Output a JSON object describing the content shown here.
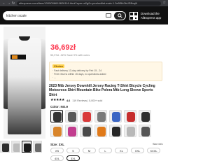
{
  "browser": {
    "url": "aliexpress.com/item/1005006619626116.html?spm=a2g0o.productlist.main.1.3e5f5b2bUSBxqN"
  },
  "header": {
    "search_value": "kitchen scale",
    "app_text": [
      "Download the",
      "AliExpress app"
    ]
  },
  "product": {
    "price": "36,69zł",
    "original_price": "53,97zł  -32%  Save 9%  with coins",
    "choice": {
      "badge": "Choice",
      "lines": [
        "· Fast delivery 13-day delivery by Feb 15 - 24",
        "· Free returns  within 15 days, no questions asked",
        "· ... "
      ]
    },
    "title": "2023 Mtb Jersey Downhill Jersey Racing T-Shirt Bicycle Cycling Motocross Shirt Mountain Bike Polera Mtb Long Sleeve Sports Shirt",
    "rating": {
      "stars": "★★★★★",
      "value": "4.6",
      "meta": "119 Reviews  |  5,000+ sold"
    },
    "color_label": "Color: NO.9",
    "swatch_colors": [
      "#333333",
      "#5a5a5a",
      "#d93a3a",
      "#7a7a7a",
      "#3b66c4",
      "#c62e2e",
      "#2e2e2e",
      "#d9852b",
      "#c23d8f",
      "#4a4a4a",
      "#e07a1a",
      "#262626",
      "#b8b8b8",
      "#555555"
    ],
    "size_label": "Size: 3XL",
    "size_info": "Size info",
    "sizes": [
      "XS",
      "S",
      "M",
      "L",
      "XL",
      "XXL",
      "XXXL",
      "4XL",
      "3XL"
    ],
    "selected_size": "3XL"
  },
  "colors": {
    "accent": "#fd384f",
    "header_bg": "#111111"
  }
}
